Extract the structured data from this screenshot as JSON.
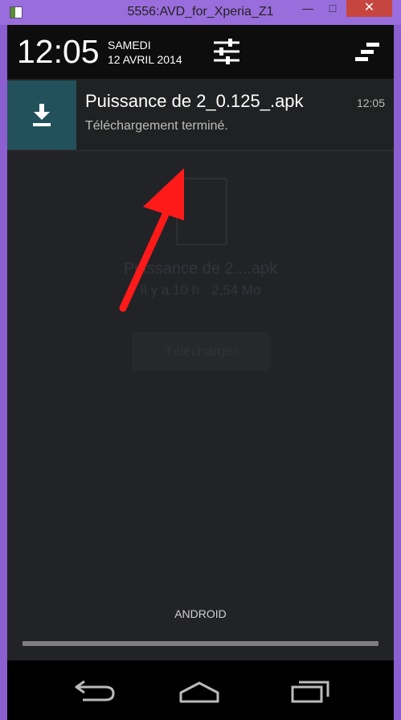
{
  "window": {
    "title": "5556:AVD_for_Xperia_Z1",
    "minimize_label": "—",
    "maximize_label": "□",
    "close_label": "✕"
  },
  "background_app": {
    "file_name": "Puissance de 2....apk",
    "file_meta": "Il y a 10 h · 2,54 Mo",
    "download_button": "Télécharger"
  },
  "status_shade": {
    "time": "12:05",
    "day": "SAMEDI",
    "date": "12 AVRIL 2014",
    "settings_icon": "quick-settings-sliders-icon",
    "clear_icon": "clear-all-icon"
  },
  "notification": {
    "icon": "download-icon",
    "icon_bg_color": "#23515b",
    "title": "Puissance de 2_0.125_.apk",
    "subtitle": "Téléchargement terminé.",
    "time": "12:05"
  },
  "carrier_label": "ANDROID",
  "nav": {
    "back_icon": "back-icon",
    "home_icon": "home-icon",
    "recent_icon": "recent-apps-icon"
  },
  "annotation": {
    "arrow_color": "#ff1a1a"
  }
}
